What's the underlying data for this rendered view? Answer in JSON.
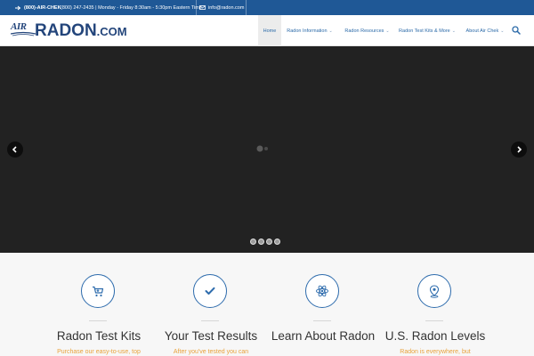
{
  "topbar": {
    "phone_label": "(800)-AIR-CHEK",
    "phone_details": "(800) 247-2435 | Monday - Friday 8:30am - 5:30pm Eastern Time",
    "email": "info@radon.com"
  },
  "logo": {
    "air": "AIR",
    "radon": "RADON",
    "dotcom": ".COM"
  },
  "nav": {
    "items": [
      {
        "label": "Home"
      },
      {
        "label": "Radon Information"
      },
      {
        "label": "Radon Resources"
      },
      {
        "label": "Radon Test Kits & More"
      },
      {
        "label": "About Air Chek"
      }
    ],
    "search_icon": "search-icon"
  },
  "slider": {
    "prev_icon": "chevron-left-icon",
    "next_icon": "chevron-right-icon",
    "slide_count": 4
  },
  "features": [
    {
      "icon": "shopping-cart-icon",
      "title": "Radon Test Kits",
      "desc": "Purchase our easy-to-use, top"
    },
    {
      "icon": "checkmark-icon",
      "title": "Your Test Results",
      "desc": "After you've tested you can"
    },
    {
      "icon": "atom-icon",
      "title": "Learn About Radon",
      "desc": ""
    },
    {
      "icon": "map-pin-icon",
      "title": "U.S. Radon Levels",
      "desc": "Radon is everywhere, but"
    }
  ],
  "colors": {
    "topbar": "#1f5896",
    "brand": "#23457b",
    "nav_link": "#2b6aa8",
    "accent": "#e8a23b"
  }
}
